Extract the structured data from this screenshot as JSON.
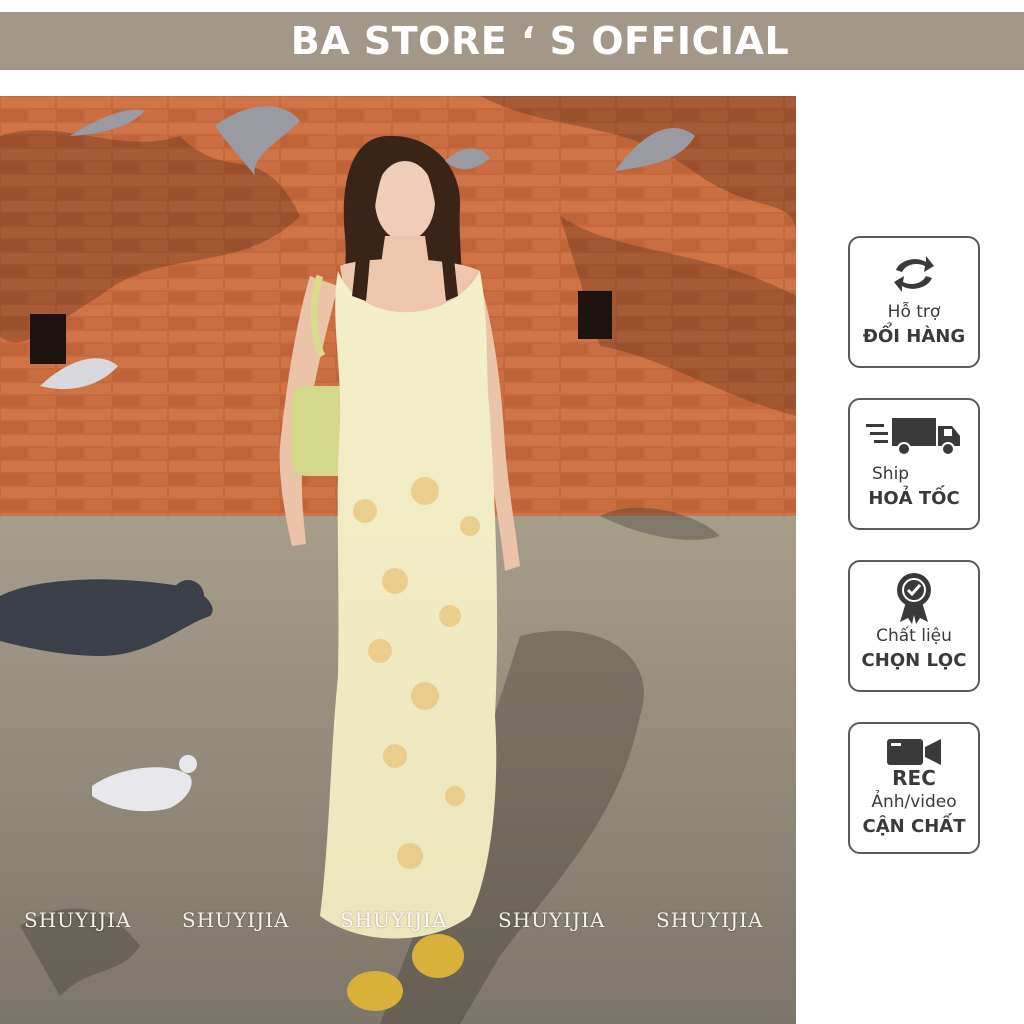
{
  "header": {
    "title": "BA STORE ‘ S OFFICIAL",
    "background": "#a39789",
    "text_color": "#ffffff"
  },
  "product_photo": {
    "description_icon": "product-model-photo",
    "watermarks": [
      "SHUYIJIA",
      "SHUYIJIA",
      "SHUYIJIA",
      "SHUYIJIA",
      "SHUYIJIA"
    ]
  },
  "badges": [
    {
      "icon": "exchange-arrows-icon",
      "line1": "Hỗ trợ",
      "line2": "ĐỔI HÀNG"
    },
    {
      "icon": "delivery-truck-icon",
      "line1": "Ship",
      "line2": "HOẢ TỐC"
    },
    {
      "icon": "quality-ribbon-icon",
      "line1": "Chất liệu",
      "line2": "CHỌN LỌC"
    },
    {
      "icon": "video-camera-icon",
      "rec": "REC",
      "line1": "Ảnh/video",
      "line2": "CẬN CHẤT"
    }
  ],
  "colors": {
    "badge_border": "#5a5a5a",
    "badge_text": "#3a3a3a",
    "brick_wall": "#c26a3f",
    "pavement": "#8f8779",
    "dress": "#f1ecc2"
  }
}
